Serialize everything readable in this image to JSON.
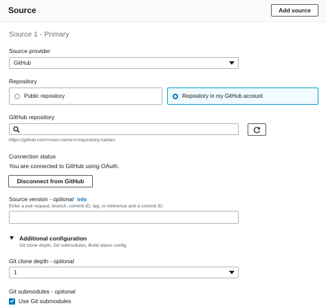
{
  "header": {
    "title": "Source",
    "add_source_label": "Add source"
  },
  "section": {
    "subtitle": "Source 1 - Primary"
  },
  "source_provider": {
    "label": "Source provider",
    "value": "GitHub"
  },
  "repository": {
    "label": "Repository",
    "options": [
      {
        "label": "Public repository",
        "selected": false
      },
      {
        "label": "Repository in my GitHub account",
        "selected": true
      }
    ]
  },
  "github_repository": {
    "label": "GitHub repository",
    "value": "",
    "hint": "https://github.com/<user-name>/<repository-name>"
  },
  "connection_status": {
    "label": "Connection status",
    "text": "You are connected to GitHub using OAuth.",
    "disconnect_label": "Disconnect from GitHub"
  },
  "source_version": {
    "label": "Source version",
    "optional": " - optional",
    "info": "Info",
    "hint": "Enter a pull request, branch, commit ID, tag, or reference and a commit ID.",
    "value": ""
  },
  "additional_configuration": {
    "title": "Additional configuration",
    "description": "Git clone depth, Git submodules, Build status config"
  },
  "git_clone_depth": {
    "label": "Git clone depth",
    "optional": " - optional",
    "value": "1"
  },
  "git_submodules": {
    "label": "Git submodules",
    "optional": " - optional",
    "checkbox_label": "Use Git submodules",
    "checked": true
  },
  "colors": {
    "accent": "#0073bb",
    "selected_border": "#00a1c9",
    "selected_bg": "#f1faff"
  }
}
